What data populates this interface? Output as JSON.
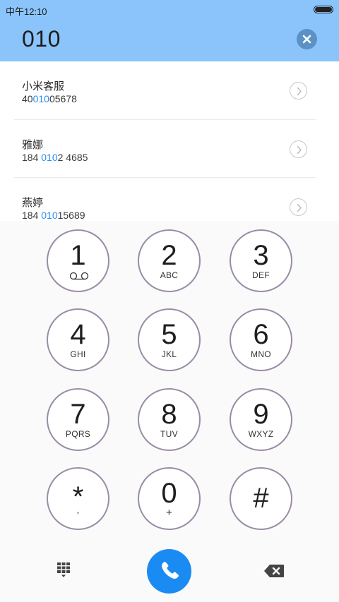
{
  "status_bar": {
    "time": "中午12:10"
  },
  "dialed_number": "010",
  "matches": [
    {
      "name": "小米客服",
      "number_before": "40",
      "number_highlight": "010",
      "number_after": "05678"
    },
    {
      "name": "雅娜",
      "number_before": "184 ",
      "number_highlight": "010",
      "number_after": "2 4685"
    },
    {
      "name": "燕婷",
      "number_before": "184 ",
      "number_highlight": "010",
      "number_after": "15689"
    }
  ],
  "keypad": [
    {
      "digit": "1",
      "sub": ""
    },
    {
      "digit": "2",
      "sub": "ABC"
    },
    {
      "digit": "3",
      "sub": "DEF"
    },
    {
      "digit": "4",
      "sub": "GHI"
    },
    {
      "digit": "5",
      "sub": "JKL"
    },
    {
      "digit": "6",
      "sub": "MNO"
    },
    {
      "digit": "7",
      "sub": "PQRS"
    },
    {
      "digit": "8",
      "sub": "TUV"
    },
    {
      "digit": "9",
      "sub": "WXYZ"
    },
    {
      "digit": "*",
      "sub": ","
    },
    {
      "digit": "0",
      "sub": "+"
    },
    {
      "digit": "#",
      "sub": ""
    }
  ],
  "icons": {
    "clear": "clear-circle-icon",
    "chevron": "chevron-right-icon",
    "voicemail": "voicemail-icon",
    "keypad_toggle": "dialpad-icon",
    "call": "phone-icon",
    "backspace": "backspace-icon"
  },
  "colors": {
    "header_bg": "#8bc4fb",
    "highlight": "#2a8ef0",
    "call_button": "#1a8bf2",
    "key_ring": "#9a8ca6"
  }
}
